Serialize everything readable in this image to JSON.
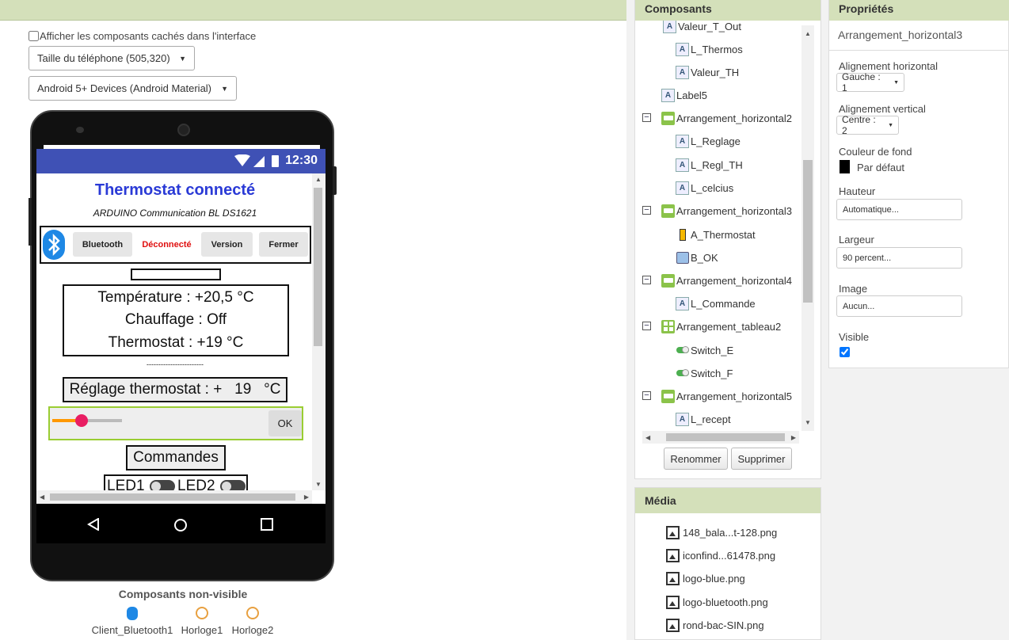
{
  "viewer": {
    "show_hidden_label": "Afficher les composants cachés dans l'interface",
    "size_select": "Taille du téléphone (505,320)",
    "theme_select": "Android 5+ Devices (Android Material)"
  },
  "phone": {
    "status_time": "12:30",
    "title": "Thermostat connecté",
    "subtitle": "ARDUINO Communication BL DS1621",
    "buttons": {
      "bluetooth": "Bluetooth",
      "status": "Déconnecté",
      "version": "Version",
      "close": "Fermer"
    },
    "temperature": "Température : +20,5 °C",
    "heating": "Chauffage : Off",
    "thermostat": "Thermostat : +19 °C",
    "dashes": "------------------------",
    "setting": "Réglage thermostat : +   19   °C",
    "slider_level": 0.42,
    "ok": "OK",
    "commands": "Commandes",
    "led1": "LED1",
    "led2": "LED2",
    "colors": {
      "status_bar": "#3f51b5",
      "title": "#2a3ad6",
      "status": "#e01010",
      "slider": "#ff9800",
      "slider_thumb": "#e91e63"
    }
  },
  "nonvisible": {
    "title": "Composants non-visible",
    "items": [
      "Client_Bluetooth1",
      "Horloge1",
      "Horloge2"
    ]
  },
  "components": {
    "header": "Composants",
    "tree": [
      {
        "label": "Valeur_T_Out",
        "icon": "label-icon"
      },
      {
        "label": "L_Thermos",
        "icon": "label-icon"
      },
      {
        "label": "Valeur_TH",
        "icon": "label-icon"
      },
      {
        "label": "Label5",
        "icon": "label-icon"
      },
      {
        "label": "Arrangement_horizontal2",
        "icon": "horizontal-arrangement-icon"
      },
      {
        "label": "L_Reglage",
        "icon": "label-icon"
      },
      {
        "label": "L_Regl_TH",
        "icon": "label-icon"
      },
      {
        "label": "L_celcius",
        "icon": "label-icon"
      },
      {
        "label": "Arrangement_horizontal3",
        "icon": "horizontal-arrangement-icon"
      },
      {
        "label": "A_Thermostat",
        "icon": "slider-icon"
      },
      {
        "label": "B_OK",
        "icon": "button-icon"
      },
      {
        "label": "Arrangement_horizontal4",
        "icon": "horizontal-arrangement-icon"
      },
      {
        "label": "L_Commande",
        "icon": "label-icon"
      },
      {
        "label": "Arrangement_tableau2",
        "icon": "table-arrangement-icon"
      },
      {
        "label": "Switch_E",
        "icon": "switch-icon"
      },
      {
        "label": "Switch_F",
        "icon": "switch-icon"
      },
      {
        "label": "Arrangement_horizontal5",
        "icon": "horizontal-arrangement-icon"
      },
      {
        "label": "L_recept",
        "icon": "label-icon"
      }
    ],
    "toggle_symbol": "⊟",
    "rename": "Renommer",
    "delete": "Supprimer"
  },
  "media": {
    "header": "Média",
    "items": [
      "148_bala...t-128.png",
      "iconfind...61478.png",
      "logo-blue.png",
      "logo-bluetooth.png",
      "rond-bac-SIN.png"
    ]
  },
  "properties": {
    "header": "Propriétés",
    "component": "Arrangement_horizontal3",
    "align_h_label": "Alignement horizontal",
    "align_h_value": "Gauche : 1",
    "align_v_label": "Alignement vertical",
    "align_v_value": "Centre : 2",
    "bg_label": "Couleur de fond",
    "bg_value": "Par défaut",
    "height_label": "Hauteur",
    "height_value": "Automatique...",
    "width_label": "Largeur",
    "width_value": "90 percent...",
    "image_label": "Image",
    "image_value": "Aucun...",
    "visible_label": "Visible"
  }
}
